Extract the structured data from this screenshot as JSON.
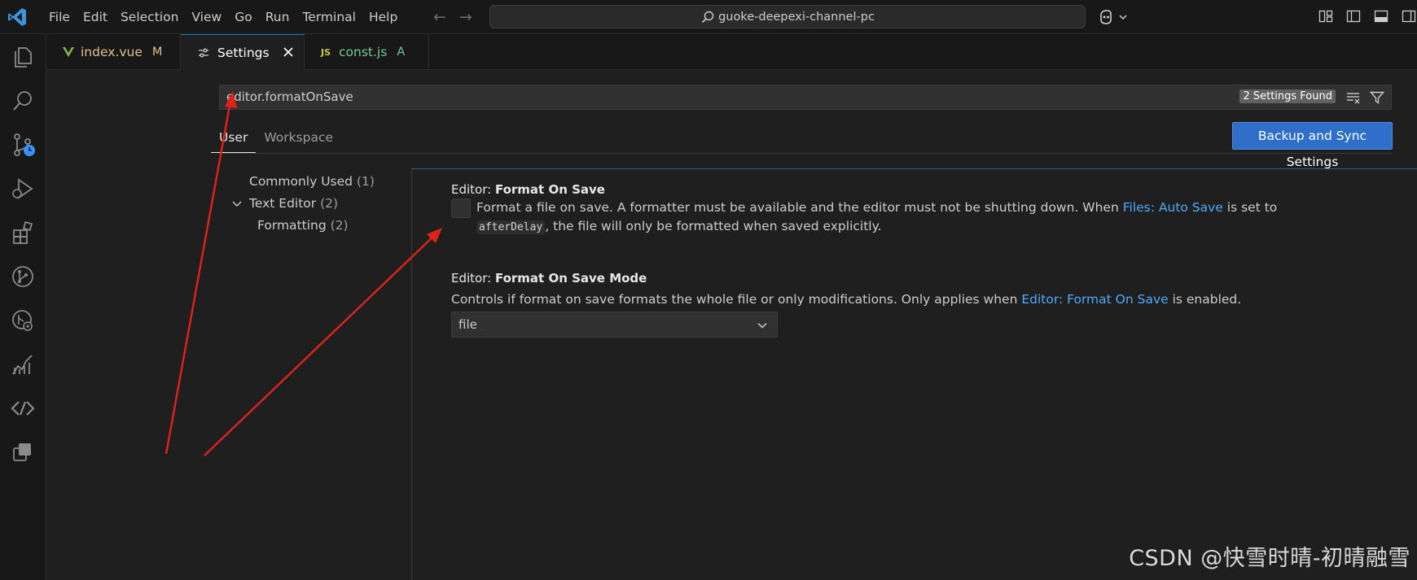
{
  "titlebar": {
    "menu": [
      "File",
      "Edit",
      "Selection",
      "View",
      "Go",
      "Run",
      "Terminal",
      "Help"
    ],
    "command_center": "guoke-deepexi-channel-pc"
  },
  "activitybar": {
    "icons": [
      "explorer-icon",
      "search-icon",
      "source-control-icon",
      "run-debug-icon",
      "extensions-icon",
      "git-graph-icon",
      "remote-explorer-icon",
      "chart-icon",
      "code-share-icon",
      "copy-icon"
    ]
  },
  "tabs": [
    {
      "label": "index.vue",
      "badge": "M",
      "active": false
    },
    {
      "label": "Settings",
      "badge": "",
      "active": true
    },
    {
      "label": "const.js",
      "badge": "A",
      "active": false
    }
  ],
  "settings": {
    "search_value": "editor.formatOnSave",
    "found": "2 Settings Found",
    "scope_tabs": [
      "User",
      "Workspace"
    ],
    "sync_button": "Backup and Sync Settings",
    "toc": [
      {
        "label": "Commonly Used",
        "count": "(1)"
      },
      {
        "label": "Text Editor",
        "count": "(2)"
      },
      {
        "label": "Formatting",
        "count": "(2)"
      }
    ],
    "items": [
      {
        "category": "Editor: ",
        "key": "Format On Save",
        "desc_before": "Format a file on save. A formatter must be available and the editor must not be shutting down. When ",
        "desc_link": "Files: Auto Save",
        "desc_middle": " is set to ",
        "desc_code": "afterDelay",
        "desc_after": ", the file will only be formatted when saved explicitly.",
        "checked": false
      },
      {
        "category": "Editor: ",
        "key": "Format On Save Mode",
        "desc_before": "Controls if format on save formats the whole file or only modifications. Only applies when ",
        "desc_link": "Editor: Format On Save",
        "desc_after": " is enabled.",
        "value": "file"
      }
    ]
  },
  "watermark": "CSDN @快雪时晴-初晴融雪",
  "colors": {
    "accent": "#0078d4",
    "link": "#4daafc",
    "button": "#2f6fca",
    "annotation_arrow": "#e0231a",
    "modified": "#e2c08d",
    "added": "#73c991"
  }
}
